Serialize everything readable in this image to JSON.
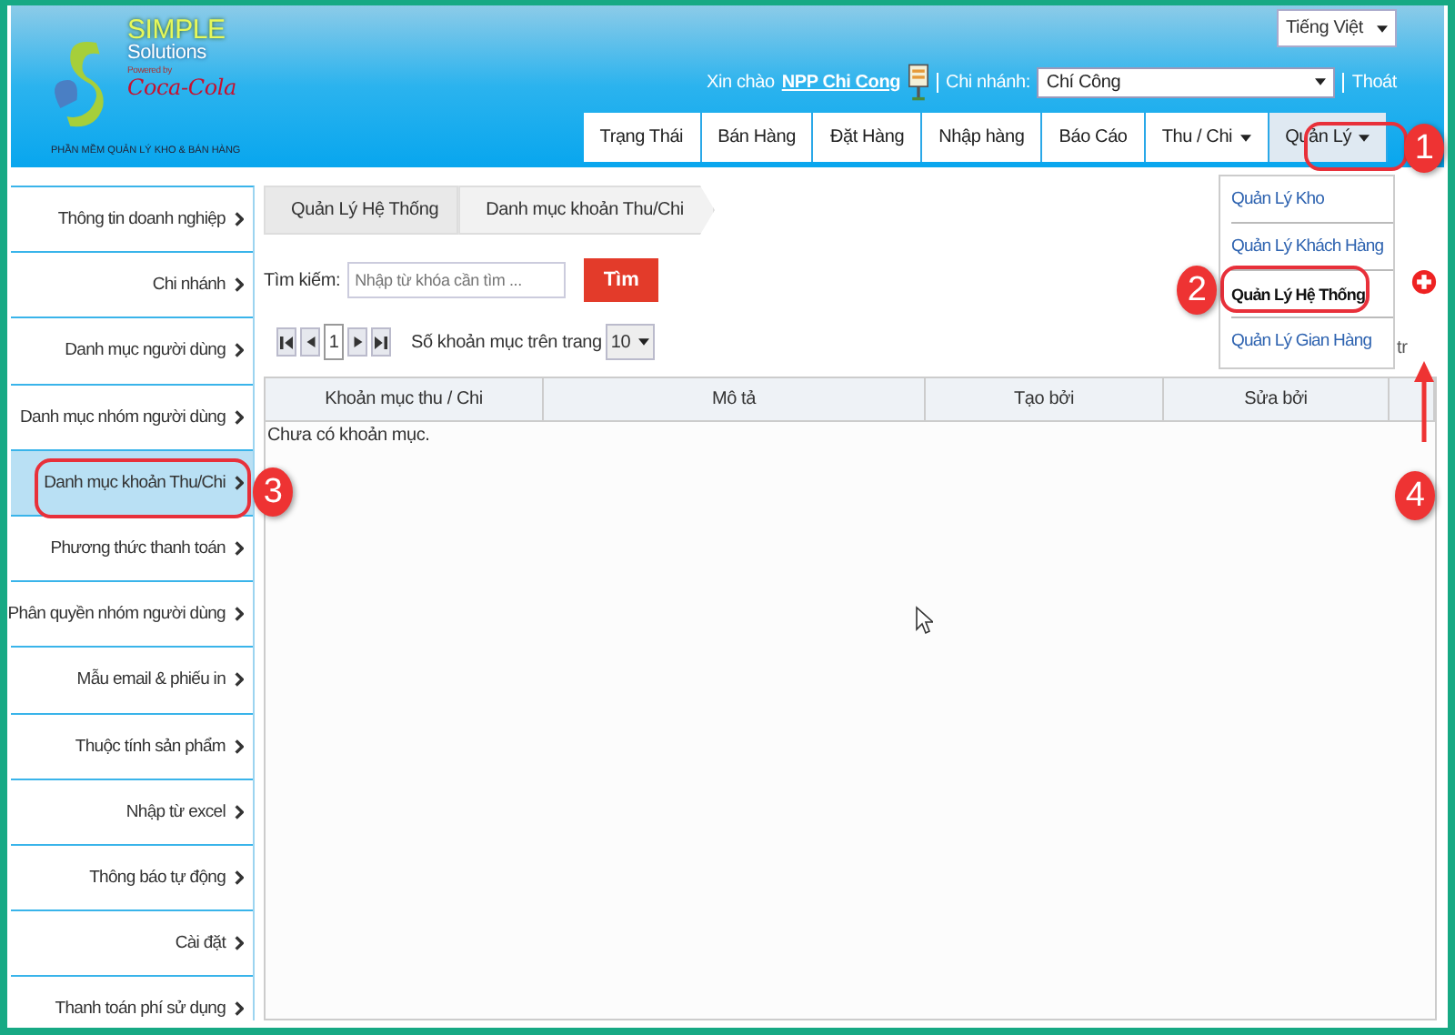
{
  "logo": {
    "title": "SIMPLE",
    "subtitle": "Solutions",
    "powered": "Powered by",
    "brand": "Coca-Cola",
    "tagline": "PHẦN MỀM QUẢN LÝ KHO & BÁN HÀNG"
  },
  "language": {
    "value": "Tiếng Việt"
  },
  "user": {
    "greeting": "Xin chào",
    "name": "NPP Chi Cong",
    "branch_label": "Chi nhánh:",
    "branch": "Chí Công",
    "logout": "Thoát"
  },
  "nav": [
    {
      "label": "Trạng Thái",
      "kind": "plain",
      "expanded": false
    },
    {
      "label": "Bán Hàng",
      "kind": "plain",
      "expanded": false
    },
    {
      "label": "Đặt Hàng",
      "kind": "plain",
      "expanded": false
    },
    {
      "label": "Nhập hàng",
      "kind": "plain",
      "expanded": false
    },
    {
      "label": "Báo Cáo",
      "kind": "plain",
      "expanded": false
    },
    {
      "label": "Thu / Chi",
      "kind": "menu",
      "expanded": false
    },
    {
      "label": "Quản Lý",
      "kind": "menu",
      "expanded": true
    }
  ],
  "dropdown": [
    {
      "label": "Quản Lý Kho",
      "selected": false
    },
    {
      "label": "Quản Lý Khách Hàng",
      "selected": false
    },
    {
      "label": "Quản Lý Hệ Thống",
      "selected": true
    },
    {
      "label": "Quản Lý Gian Hàng",
      "selected": false
    }
  ],
  "sidebar": [
    {
      "label": "Thông tin doanh nghiệp",
      "selected": false
    },
    {
      "label": "Chi nhánh",
      "selected": false
    },
    {
      "label": "Danh mục người dùng",
      "selected": false
    },
    {
      "label": "Danh mục nhóm người dùng",
      "selected": false
    },
    {
      "label": "Danh mục khoản Thu/Chi",
      "selected": true
    },
    {
      "label": "Phương thức thanh toán",
      "selected": false
    },
    {
      "label": "Phân quyền nhóm người dùng",
      "selected": false
    },
    {
      "label": "Mẫu email & phiếu in",
      "selected": false
    },
    {
      "label": "Thuộc tính sản phẩm",
      "selected": false
    },
    {
      "label": "Nhập từ excel",
      "selected": false
    },
    {
      "label": "Thông báo tự động",
      "selected": false
    },
    {
      "label": "Cài đặt",
      "selected": false
    },
    {
      "label": "Thanh toán phí sử dụng",
      "selected": false
    }
  ],
  "breadcrumb": [
    "Quản Lý Hệ Thống",
    "Danh mục khoản Thu/Chi"
  ],
  "search": {
    "label": "Tìm kiếm:",
    "placeholder": "Nhập từ khóa cần tìm ...",
    "button": "Tìm"
  },
  "pager": {
    "page": "1",
    "per_page_label": "Số khoản mục trên trang",
    "per_page": "10",
    "hidden_text": "tr"
  },
  "table": {
    "columns": [
      "Khoản mục thu / Chi",
      "Mô tả",
      "Tạo bởi",
      "Sửa bởi"
    ],
    "empty": "Chưa có khoản mục."
  },
  "annotations": [
    {
      "label": "1"
    },
    {
      "label": "2"
    },
    {
      "label": "3"
    },
    {
      "label": "4"
    }
  ]
}
